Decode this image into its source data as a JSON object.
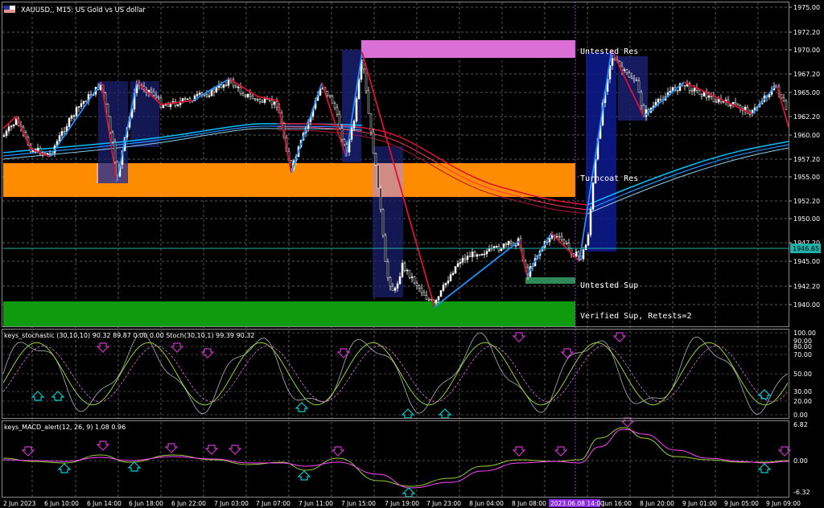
{
  "header": {
    "title": "XAUUSD,, M15:  US Gold vs US dollar"
  },
  "zones": {
    "untested_res": "Untested Res",
    "turncoat_res": "Turncoat Res",
    "untested_sup": "Untested Sup",
    "verified_sup": "Verified Sup, Retests=2"
  },
  "price_axis": {
    "ticks": [
      "1975.00",
      "1972.20",
      "1970.00",
      "1967.20",
      "1965.00",
      "1962.20",
      "1960.00",
      "1957.20",
      "1955.00",
      "1952.20",
      "1950.00",
      "1947.20",
      "1945.00",
      "1942.20",
      "1940.00"
    ],
    "current_price": "1946.65"
  },
  "stochastic": {
    "title": "keys_stochastic (30,10,10) 90.32 89.87 0.00 0.00 Stoch(30,10,1) 99.39 90.32",
    "ticks": [
      "100.00",
      "90.00",
      "80.00",
      "70.00",
      "50.00",
      "30.00",
      "20.00",
      "0.00"
    ]
  },
  "macd": {
    "title": "keys_MACD_alert(12, 26, 9) 1.08 0.96",
    "ticks": [
      "6.82",
      "0.00",
      "-6.32"
    ]
  },
  "time_axis": {
    "labels": [
      "2 Jun 2023",
      "6 Jun 10:00",
      "6 Jun 14:00",
      "6 Jun 18:00",
      "6 Jun 22:00",
      "7 Jun 03:00",
      "7 Jun 07:00",
      "7 Jun 11:00",
      "7 Jun 15:00",
      "7 Jun 19:00",
      "7 Jun 23:00",
      "8 Jun 04:00",
      "8 Jun 08:00",
      "8 Jun 16:00",
      "8 Jun 20:00",
      "9 Jun 01:00",
      "9 Jun 05:00",
      "9 Jun 09:00"
    ],
    "highlight": "2023.06.08 14:00"
  },
  "colors": {
    "background": "#000000",
    "grid": "#8a8a8a",
    "candle": "#ffffff",
    "up_leg": "#1e90ff",
    "down_leg": "#dd1133",
    "res_zone_untested": "#da70d6",
    "res_zone_turncoat": "#ff8c00",
    "sup_zone_verified": "#0e9c0e",
    "sup_zone_untested": "#2e8b57",
    "current_price_line": "#20b2aa",
    "stoch_fast": "#9aa0aa",
    "stoch_main": "#9acd32",
    "stoch_signal": "#da70d6",
    "macd_main": "#9acd32",
    "macd_signal": "#ff44ff",
    "arrow_up": "#00ced1",
    "arrow_down": "#cc33cc"
  }
}
